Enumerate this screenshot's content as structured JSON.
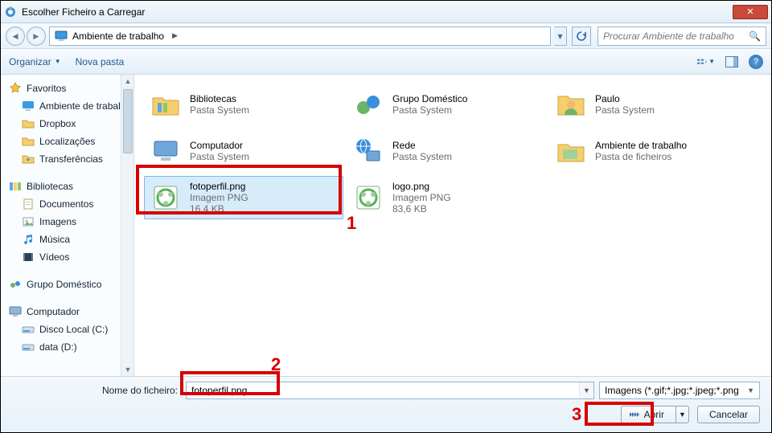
{
  "window": {
    "title": "Escolher Ficheiro a Carregar"
  },
  "nav": {
    "location_label": "Ambiente de trabalho",
    "search_placeholder": "Procurar Ambiente de trabalho"
  },
  "toolbar": {
    "organize": "Organizar",
    "new_folder": "Nova pasta"
  },
  "sidebar": {
    "favorites": {
      "head": "Favoritos",
      "items": [
        "Ambiente de trabalho",
        "Dropbox",
        "Localizações",
        "Transferências"
      ]
    },
    "bibliotecas": {
      "head": "Bibliotecas",
      "items": [
        "Documentos",
        "Imagens",
        "Música",
        "Vídeos"
      ]
    },
    "group": {
      "head": "Grupo Doméstico"
    },
    "computer": {
      "head": "Computador",
      "items": [
        "Disco Local (C:)",
        "data (D:)"
      ]
    }
  },
  "files": [
    {
      "name": "Bibliotecas",
      "sub": "Pasta System",
      "kind": "lib"
    },
    {
      "name": "Grupo Doméstico",
      "sub": "Pasta System",
      "kind": "group"
    },
    {
      "name": "Paulo",
      "sub": "Pasta System",
      "kind": "user"
    },
    {
      "name": "Computador",
      "sub": "Pasta System",
      "kind": "pc"
    },
    {
      "name": "Rede",
      "sub": "Pasta System",
      "kind": "net"
    },
    {
      "name": "Ambiente de trabalho",
      "sub": "Pasta de ficheiros",
      "kind": "folder"
    },
    {
      "name": "fotoperfil.png",
      "sub": "Imagem PNG",
      "sub2": "16,4 KB",
      "kind": "png",
      "selected": true
    },
    {
      "name": "logo.png",
      "sub": "Imagem PNG",
      "sub2": "83,6 KB",
      "kind": "png"
    }
  ],
  "footer": {
    "filename_label": "Nome do ficheiro:",
    "filename_value": "fotoperfil.png",
    "filter_value": "Imagens (*.gif;*.jpg;*.jpeg;*.png",
    "open": "Abrir",
    "cancel": "Cancelar"
  },
  "annotations": {
    "a1": "1",
    "a2": "2",
    "a3": "3"
  }
}
